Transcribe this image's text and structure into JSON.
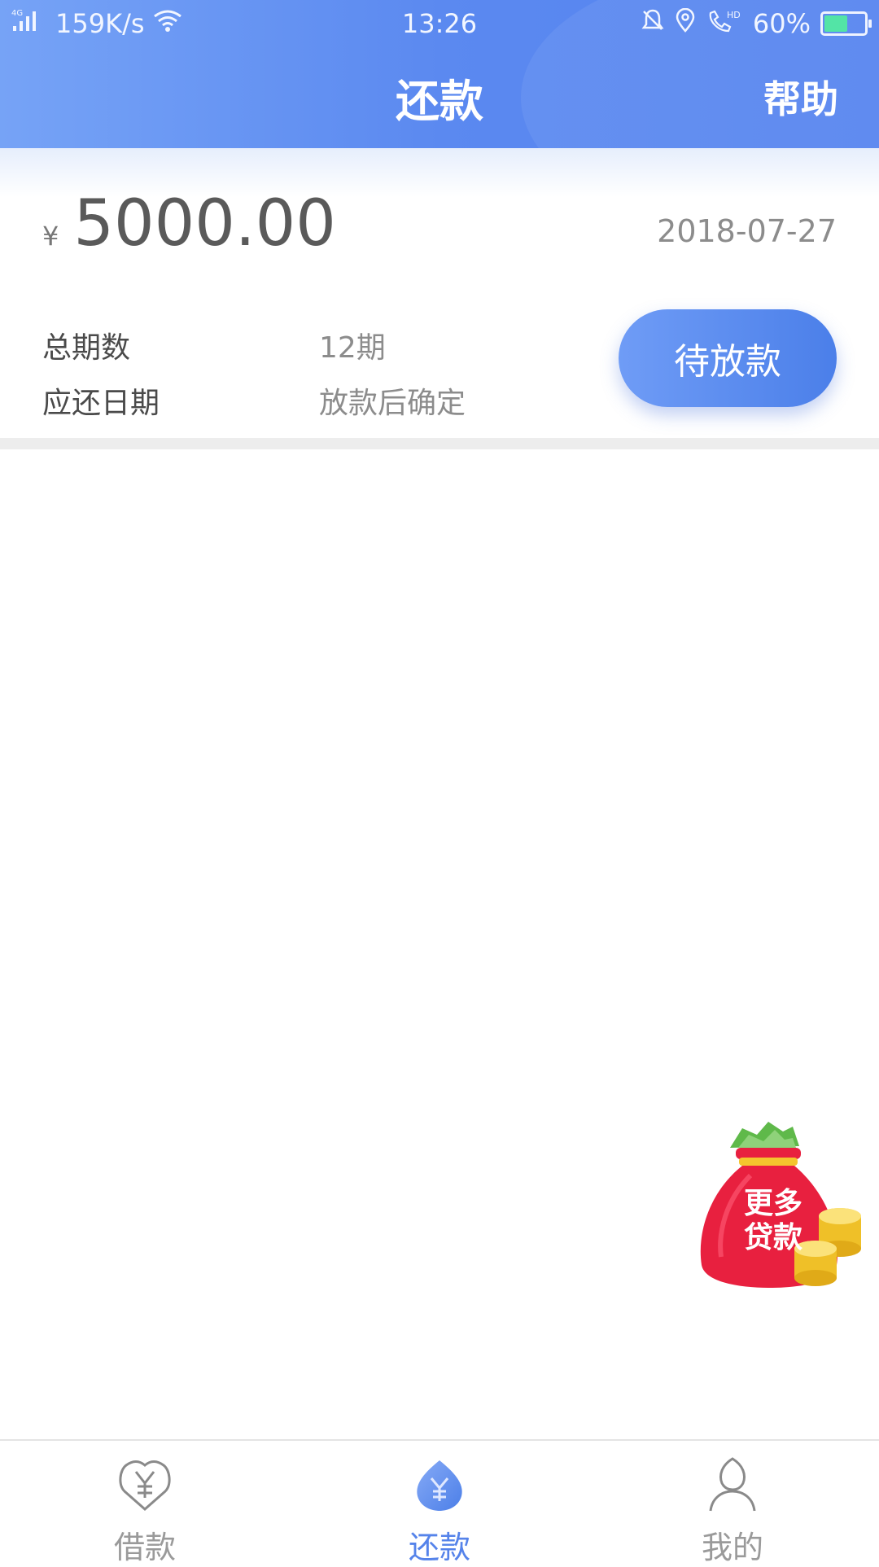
{
  "status_bar": {
    "network": "4G",
    "speed": "159K/s",
    "time": "13:26",
    "hd": "HD",
    "battery": "60%",
    "battery_level": 0.6
  },
  "header": {
    "title": "还款",
    "help_label": "帮助"
  },
  "loan": {
    "currency_symbol": "¥",
    "amount": "5000.00",
    "date": "2018-07-27",
    "periods_label": "总期数",
    "periods_value": "12期",
    "due_label": "应还日期",
    "due_value": "放款后确定",
    "status_button": "待放款"
  },
  "promo": {
    "line1": "更多",
    "line2": "贷款"
  },
  "tabs": [
    {
      "label": "借款",
      "icon": "yen-heart-icon",
      "active": false
    },
    {
      "label": "还款",
      "icon": "yen-heart-filled-icon",
      "active": true
    },
    {
      "label": "我的",
      "icon": "person-icon",
      "active": false
    }
  ],
  "colors": {
    "brand": "#5583ea",
    "promo_red": "#e8203f"
  }
}
